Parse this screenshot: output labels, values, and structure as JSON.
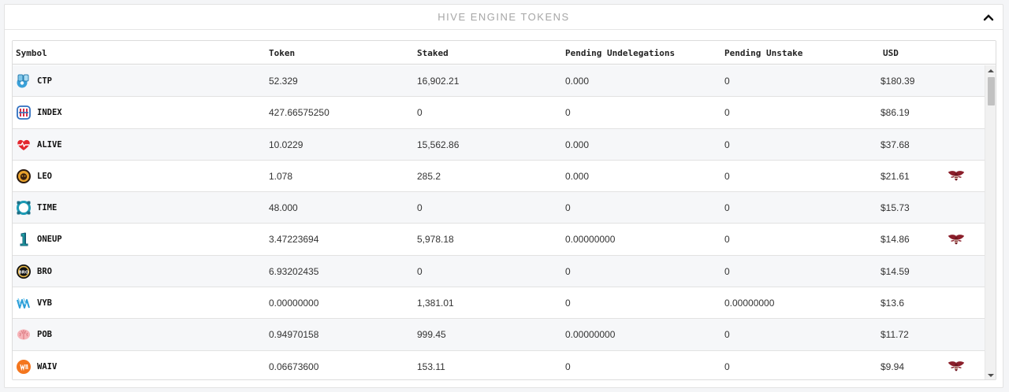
{
  "panel": {
    "title": "HIVE ENGINE TOKENS"
  },
  "table": {
    "headers": {
      "symbol": "Symbol",
      "token": "Token",
      "staked": "Staked",
      "pending_undelegations": "Pending Undelegations",
      "pending_unstake": "Pending Unstake",
      "usd": "USD"
    },
    "rows": [
      {
        "symbol": "CTP",
        "icon": "ctp-token-icon",
        "token": "52.329",
        "staked": "16,902.21",
        "pending_undelegations": "0.000",
        "pending_unstake": "0",
        "usd": "$180.39",
        "has_action": false
      },
      {
        "symbol": "INDEX",
        "icon": "index-token-icon",
        "token": "427.66575250",
        "staked": "0",
        "pending_undelegations": "0",
        "pending_unstake": "0",
        "usd": "$86.19",
        "has_action": false
      },
      {
        "symbol": "ALIVE",
        "icon": "alive-token-icon",
        "token": "10.0229",
        "staked": "15,562.86",
        "pending_undelegations": "0.000",
        "pending_unstake": "0",
        "usd": "$37.68",
        "has_action": false
      },
      {
        "symbol": "LEO",
        "icon": "leo-token-icon",
        "token": "1.078",
        "staked": "285.2",
        "pending_undelegations": "0.000",
        "pending_unstake": "0",
        "usd": "$21.61",
        "has_action": true
      },
      {
        "symbol": "TIME",
        "icon": "time-token-icon",
        "token": "48.000",
        "staked": "0",
        "pending_undelegations": "0",
        "pending_unstake": "0",
        "usd": "$15.73",
        "has_action": false
      },
      {
        "symbol": "ONEUP",
        "icon": "oneup-token-icon",
        "token": "3.47223694",
        "staked": "5,978.18",
        "pending_undelegations": "0.00000000",
        "pending_unstake": "0",
        "usd": "$14.86",
        "has_action": true
      },
      {
        "symbol": "BRO",
        "icon": "bro-token-icon",
        "token": "6.93202435",
        "staked": "0",
        "pending_undelegations": "0",
        "pending_unstake": "0",
        "usd": "$14.59",
        "has_action": false
      },
      {
        "symbol": "VYB",
        "icon": "vyb-token-icon",
        "token": "0.00000000",
        "staked": "1,381.01",
        "pending_undelegations": "0",
        "pending_unstake": "0.00000000",
        "usd": "$13.6",
        "has_action": false
      },
      {
        "symbol": "POB",
        "icon": "pob-token-icon",
        "token": "0.94970158",
        "staked": "999.45",
        "pending_undelegations": "0.00000000",
        "pending_unstake": "0",
        "usd": "$11.72",
        "has_action": false
      },
      {
        "symbol": "WAIV",
        "icon": "waiv-token-icon",
        "token": "0.06673600",
        "staked": "153.11",
        "pending_undelegations": "0",
        "pending_unstake": "0",
        "usd": "$9.94",
        "has_action": true
      }
    ]
  },
  "icons": {
    "collapse": "chevron-up-icon",
    "action": "hive-bee-icon"
  },
  "colors": {
    "title": "#a6a6a6",
    "action_icon": "#8b1e2a",
    "row_stripe": "#f6f7f9"
  }
}
